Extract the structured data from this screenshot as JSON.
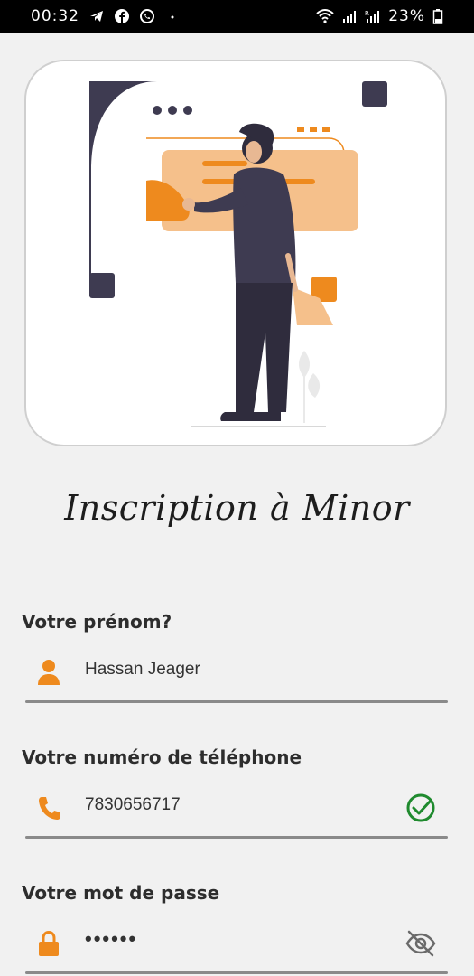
{
  "status_bar": {
    "time": "00:32",
    "battery": "23%",
    "left_icons": [
      "telegram-icon",
      "facebook-icon",
      "whatsapp-icon",
      "dot-icon"
    ],
    "right_icons": [
      "wifi-icon",
      "signal-icon",
      "signal-r-icon",
      "battery-icon"
    ]
  },
  "title": "Inscription à Minor",
  "fields": {
    "first_name": {
      "label": "Votre prénom?",
      "value": "Hassan Jeager",
      "icon": "person-icon"
    },
    "phone": {
      "label": "Votre numéro de téléphone",
      "value": "7830656717",
      "icon": "phone-icon",
      "trailing_icon": "check-circle-icon"
    },
    "password": {
      "label": "Votre mot de passe",
      "value": "••••••",
      "icon": "lock-icon",
      "trailing_icon": "eye-off-icon"
    }
  },
  "colors": {
    "accent": "#ee8a1e",
    "accent_light": "#f5c08b",
    "dark": "#3e3b51",
    "success": "#1f8a2e"
  }
}
